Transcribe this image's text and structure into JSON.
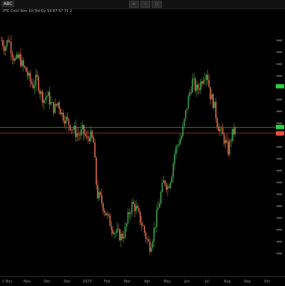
{
  "header": {
    "ticker": "ABC",
    "info_line": "PTC  Cntrl  Stm  1H  Trd  Dy  54  87  57  71  2"
  },
  "toolbar": [
    "+",
    "–",
    "▢"
  ],
  "chart_data": {
    "type": "candlestick",
    "ylim": [
      0,
      100
    ],
    "levels": [
      {
        "name": "upper",
        "value": 58.3,
        "color": "#3d8b3d"
      },
      {
        "name": "lower",
        "value": 55.8,
        "color": "#c0392b"
      }
    ],
    "price_badges": [
      {
        "value": 75.7,
        "color": "#2ecc40"
      },
      {
        "value": 58.3,
        "color": "#2ecc40"
      },
      {
        "value": 55.8,
        "color": "#e74c3c"
      }
    ],
    "x_tick_labels": [
      "1 Nov",
      "Nov",
      "Dec",
      "Dec",
      "2023",
      "Feb",
      "Mar",
      "Apr",
      "May",
      "Jun",
      "Jul",
      "Aug",
      "Sep",
      "Oct"
    ],
    "colors": {
      "up": "#3fa34d",
      "down": "#e0704a"
    },
    "close_path": [
      [
        0,
        95
      ],
      [
        5,
        92
      ],
      [
        10,
        96
      ],
      [
        15,
        90
      ],
      [
        20,
        86
      ],
      [
        25,
        88
      ],
      [
        30,
        84
      ],
      [
        35,
        82
      ],
      [
        40,
        78
      ],
      [
        45,
        76
      ],
      [
        50,
        79
      ],
      [
        55,
        73
      ],
      [
        60,
        70
      ],
      [
        65,
        72
      ],
      [
        70,
        68
      ],
      [
        75,
        66
      ],
      [
        80,
        69
      ],
      [
        85,
        64
      ],
      [
        90,
        62
      ],
      [
        95,
        60
      ],
      [
        100,
        58
      ],
      [
        105,
        56
      ],
      [
        110,
        55
      ],
      [
        115,
        57
      ],
      [
        120,
        53
      ],
      [
        125,
        55
      ],
      [
        130,
        52
      ],
      [
        135,
        30
      ],
      [
        140,
        28
      ],
      [
        145,
        24
      ],
      [
        150,
        20
      ],
      [
        155,
        17
      ],
      [
        160,
        14
      ],
      [
        165,
        13
      ],
      [
        170,
        12
      ],
      [
        175,
        15
      ],
      [
        180,
        22
      ],
      [
        185,
        26
      ],
      [
        190,
        24
      ],
      [
        195,
        20
      ],
      [
        200,
        16
      ],
      [
        205,
        11
      ],
      [
        210,
        8
      ],
      [
        215,
        14
      ],
      [
        220,
        22
      ],
      [
        225,
        30
      ],
      [
        230,
        36
      ],
      [
        235,
        33
      ],
      [
        240,
        38
      ],
      [
        245,
        48
      ],
      [
        250,
        52
      ],
      [
        255,
        55
      ],
      [
        260,
        64
      ],
      [
        265,
        72
      ],
      [
        270,
        78
      ],
      [
        275,
        74
      ],
      [
        280,
        76
      ],
      [
        285,
        80
      ],
      [
        290,
        82
      ],
      [
        295,
        72
      ],
      [
        300,
        68
      ],
      [
        305,
        60
      ],
      [
        310,
        56
      ],
      [
        315,
        53
      ],
      [
        320,
        48
      ],
      [
        325,
        55
      ],
      [
        330,
        57
      ]
    ]
  }
}
